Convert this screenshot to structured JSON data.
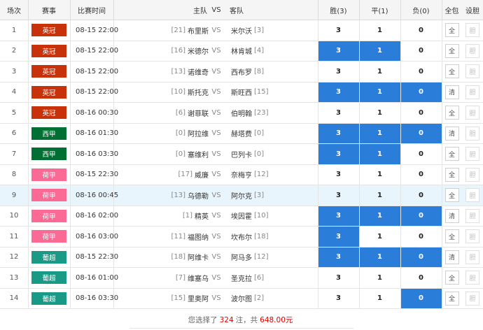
{
  "headers": {
    "index": "场次",
    "league": "赛事",
    "time": "比赛时间",
    "home": "主队",
    "vs": "VS",
    "away": "客队",
    "win": "胜(3)",
    "draw": "平(1)",
    "lose": "负(0)",
    "all": "全包",
    "settings": "设胆"
  },
  "colors": {
    "英冠": "#c8320a",
    "西甲": "#006f33",
    "荷甲": "#fb6a95",
    "葡超": "#199a87",
    "selected": "#2a7dd8"
  },
  "rows": [
    {
      "idx": "1",
      "league": "英冠",
      "time": "08-15 22:00",
      "home_rank": "[21]",
      "home": "布里斯",
      "vs": "VS",
      "away": "米尔沃",
      "away_rank": "[3]",
      "w": "3",
      "d": "1",
      "l": "0",
      "w_sel": false,
      "d_sel": false,
      "l_sel": false,
      "all_label": "全",
      "all_dim": false,
      "set_label": "胆",
      "set_dim": true
    },
    {
      "idx": "2",
      "league": "英冠",
      "time": "08-15 22:00",
      "home_rank": "[16]",
      "home": "米德尔",
      "vs": "VS",
      "away": "林肯城",
      "away_rank": "[4]",
      "w": "3",
      "d": "1",
      "l": "0",
      "w_sel": true,
      "d_sel": true,
      "l_sel": false,
      "all_label": "全",
      "all_dim": false,
      "set_label": "胆",
      "set_dim": true
    },
    {
      "idx": "3",
      "league": "英冠",
      "time": "08-15 22:00",
      "home_rank": "[13]",
      "home": "诺维奇",
      "vs": "VS",
      "away": "西布罗",
      "away_rank": "[8]",
      "w": "3",
      "d": "1",
      "l": "0",
      "w_sel": false,
      "d_sel": false,
      "l_sel": false,
      "all_label": "全",
      "all_dim": false,
      "set_label": "胆",
      "set_dim": true
    },
    {
      "idx": "4",
      "league": "英冠",
      "time": "08-15 22:00",
      "home_rank": "[10]",
      "home": "斯托克",
      "vs": "VS",
      "away": "斯旺西",
      "away_rank": "[15]",
      "w": "3",
      "d": "1",
      "l": "0",
      "w_sel": true,
      "d_sel": true,
      "l_sel": true,
      "all_label": "清",
      "all_dim": false,
      "set_label": "胆",
      "set_dim": true
    },
    {
      "idx": "5",
      "league": "英冠",
      "time": "08-16 00:30",
      "home_rank": "[6]",
      "home": "谢菲联",
      "vs": "VS",
      "away": "伯明翰",
      "away_rank": "[23]",
      "w": "3",
      "d": "1",
      "l": "0",
      "w_sel": false,
      "d_sel": false,
      "l_sel": false,
      "all_label": "全",
      "all_dim": false,
      "set_label": "胆",
      "set_dim": true
    },
    {
      "idx": "6",
      "league": "西甲",
      "time": "08-16 01:30",
      "home_rank": "[0]",
      "home": "阿拉维",
      "vs": "VS",
      "away": "赫塔费",
      "away_rank": "[0]",
      "w": "3",
      "d": "1",
      "l": "0",
      "w_sel": true,
      "d_sel": true,
      "l_sel": true,
      "all_label": "清",
      "all_dim": false,
      "set_label": "胆",
      "set_dim": true
    },
    {
      "idx": "7",
      "league": "西甲",
      "time": "08-16 03:30",
      "home_rank": "[0]",
      "home": "塞维利",
      "vs": "VS",
      "away": "巴列卡",
      "away_rank": "[0]",
      "w": "3",
      "d": "1",
      "l": "0",
      "w_sel": true,
      "d_sel": true,
      "l_sel": false,
      "all_label": "全",
      "all_dim": false,
      "set_label": "胆",
      "set_dim": true
    },
    {
      "idx": "8",
      "league": "荷甲",
      "time": "08-15 22:30",
      "home_rank": "[17]",
      "home": "威廉",
      "vs": "VS",
      "away": "奈梅亨",
      "away_rank": "[12]",
      "w": "3",
      "d": "1",
      "l": "0",
      "w_sel": false,
      "d_sel": false,
      "l_sel": false,
      "all_label": "全",
      "all_dim": false,
      "set_label": "胆",
      "set_dim": true
    },
    {
      "idx": "9",
      "league": "荷甲",
      "time": "08-16 00:45",
      "home_rank": "[13]",
      "home": "乌德勒",
      "vs": "VS",
      "away": "阿尔克",
      "away_rank": "[3]",
      "w": "3",
      "d": "1",
      "l": "0",
      "w_sel": false,
      "d_sel": false,
      "l_sel": false,
      "all_label": "全",
      "all_dim": false,
      "set_label": "胆",
      "set_dim": true,
      "highlight": true
    },
    {
      "idx": "10",
      "league": "荷甲",
      "time": "08-16 02:00",
      "home_rank": "[1]",
      "home": "精英",
      "vs": "VS",
      "away": "埃因霍",
      "away_rank": "[10]",
      "w": "3",
      "d": "1",
      "l": "0",
      "w_sel": true,
      "d_sel": true,
      "l_sel": true,
      "all_label": "清",
      "all_dim": false,
      "set_label": "胆",
      "set_dim": true
    },
    {
      "idx": "11",
      "league": "荷甲",
      "time": "08-16 03:00",
      "home_rank": "[11]",
      "home": "福图纳",
      "vs": "VS",
      "away": "坎布尔",
      "away_rank": "[18]",
      "w": "3",
      "d": "1",
      "l": "0",
      "w_sel": true,
      "d_sel": false,
      "l_sel": false,
      "all_label": "全",
      "all_dim": false,
      "set_label": "胆",
      "set_dim": true
    },
    {
      "idx": "12",
      "league": "葡超",
      "time": "08-15 22:30",
      "home_rank": "[18]",
      "home": "阿维卡",
      "vs": "VS",
      "away": "阿马多",
      "away_rank": "[12]",
      "w": "3",
      "d": "1",
      "l": "0",
      "w_sel": true,
      "d_sel": true,
      "l_sel": true,
      "all_label": "清",
      "all_dim": false,
      "set_label": "胆",
      "set_dim": true
    },
    {
      "idx": "13",
      "league": "葡超",
      "time": "08-16 01:00",
      "home_rank": "[7]",
      "home": "维塞乌",
      "vs": "VS",
      "away": "圣克拉",
      "away_rank": "[6]",
      "w": "3",
      "d": "1",
      "l": "0",
      "w_sel": false,
      "d_sel": false,
      "l_sel": false,
      "all_label": "全",
      "all_dim": false,
      "set_label": "胆",
      "set_dim": true
    },
    {
      "idx": "14",
      "league": "葡超",
      "time": "08-16 03:30",
      "home_rank": "[15]",
      "home": "里奥阿",
      "vs": "VS",
      "away": "波尔图",
      "away_rank": "[2]",
      "w": "3",
      "d": "1",
      "l": "0",
      "w_sel": false,
      "d_sel": false,
      "l_sel": true,
      "all_label": "全",
      "all_dim": false,
      "set_label": "胆",
      "set_dim": true
    }
  ],
  "footer": {
    "prefix": "您选择了",
    "count": "324",
    "mid": "注，共",
    "amount": "648.00元"
  }
}
